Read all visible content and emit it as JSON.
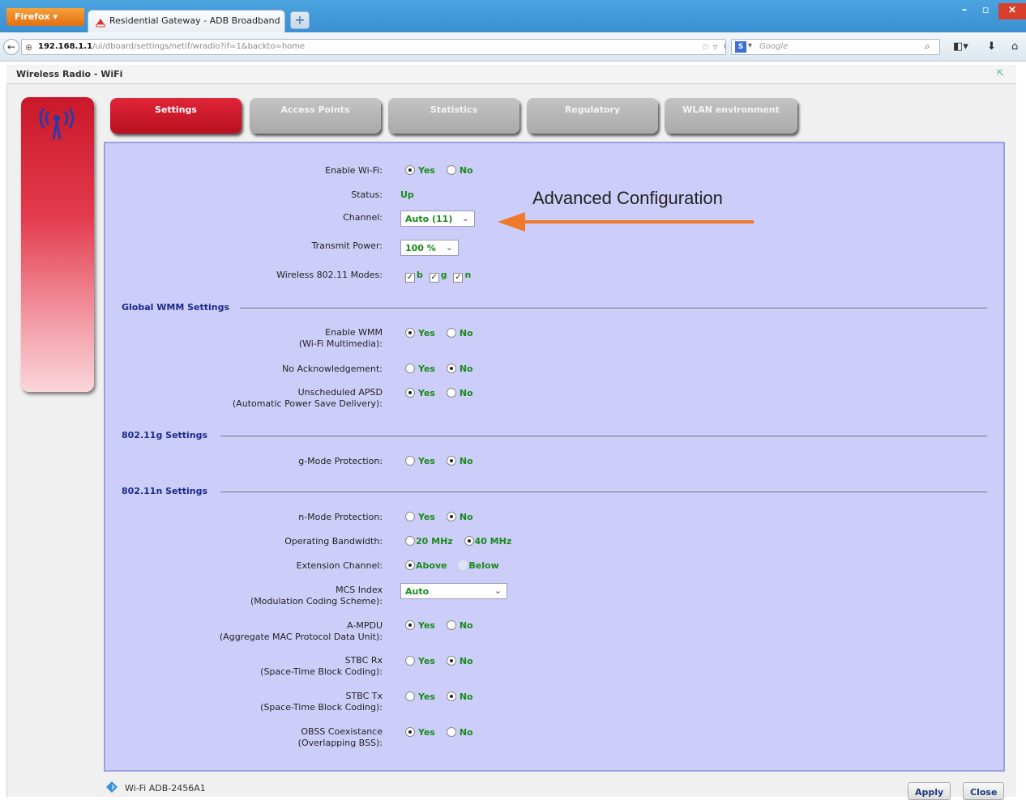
{
  "browser": {
    "menu_button": "Firefox",
    "tab_title": "Residential Gateway - ADB Broadband",
    "new_tab": "+",
    "url_host": "192.168.1.1",
    "url_path": "/ui/dboard/settings/netif/wradio?if=1&backto=home",
    "search_engine": "Google",
    "search_engine_icon": "S",
    "window_minimize": "–",
    "window_maximize": "▫",
    "window_close": "×"
  },
  "page": {
    "title": "Wireless Radio - WiFi"
  },
  "tabs": [
    {
      "label": "Settings",
      "active": true
    },
    {
      "label": "Access Points",
      "active": false
    },
    {
      "label": "Statistics",
      "active": false
    },
    {
      "label": "Regulatory",
      "active": false
    },
    {
      "label": "WLAN environment",
      "active": false
    }
  ],
  "settings": {
    "enable_wifi": {
      "label": "Enable Wi-Fi:",
      "yes": "Yes",
      "no": "No",
      "selected": "yes"
    },
    "status": {
      "label": "Status:",
      "value": "Up"
    },
    "channel": {
      "label": "Channel:",
      "value": "Auto (11)"
    },
    "transmit_power": {
      "label": "Transmit Power:",
      "value": "100 %"
    },
    "modes": {
      "label": "Wireless 802.11 Modes:",
      "b": "b",
      "g": "g",
      "n": "n"
    }
  },
  "wmm": {
    "section": "Global WMM Settings",
    "enable_wmm": {
      "label1": "Enable WMM",
      "label2": "(Wi-Fi Multimedia):",
      "yes": "Yes",
      "no": "No",
      "selected": "yes"
    },
    "no_ack": {
      "label": "No Acknowledgement:",
      "yes": "Yes",
      "no": "No",
      "selected": "no"
    },
    "apsd": {
      "label1": "Unscheduled APSD",
      "label2": "(Automatic Power Save Delivery):",
      "yes": "Yes",
      "no": "No",
      "selected": "yes"
    }
  },
  "g_settings": {
    "section": "802.11g Settings",
    "g_protection": {
      "label": "g-Mode Protection:",
      "yes": "Yes",
      "no": "No",
      "selected": "no"
    }
  },
  "n_settings": {
    "section": "802.11n Settings",
    "n_protection": {
      "label": "n-Mode Protection:",
      "yes": "Yes",
      "no": "No",
      "selected": "no"
    },
    "bandwidth": {
      "label": "Operating Bandwidth:",
      "opt1": "20 MHz",
      "opt2": "40 MHz",
      "selected": "40 MHz"
    },
    "extension": {
      "label": "Extension Channel:",
      "opt1": "Above",
      "opt2": "Below",
      "selected": "Above"
    },
    "mcs": {
      "label1": "MCS Index",
      "label2": "(Modulation Coding Scheme):",
      "value": "Auto"
    },
    "ampdu": {
      "label1": "A-MPDU",
      "label2": "(Aggregate MAC Protocol Data Unit):",
      "yes": "Yes",
      "no": "No",
      "selected": "yes"
    },
    "stbc_rx": {
      "label1": "STBC Rx",
      "label2": "(Space-Time Block Coding):",
      "yes": "Yes",
      "no": "No",
      "selected": "no"
    },
    "stbc_tx": {
      "label1": "STBC Tx",
      "label2": "(Space-Time Block Coding):",
      "yes": "Yes",
      "no": "No",
      "selected": "no"
    },
    "obss": {
      "label1": "OBSS Coexistance",
      "label2": "(Overlapping BSS):",
      "yes": "Yes",
      "no": "No",
      "selected": "yes"
    }
  },
  "annotation": {
    "text": "Advanced Configuration",
    "color": "#f07a2c"
  },
  "footer": {
    "network": "Wi-Fi ADB-2456A1",
    "apply": "Apply",
    "close": "Close"
  },
  "colors": {
    "accent_red": "#c9182a",
    "panel_bg": "#cdcdf9",
    "value_green": "#1a8a1a",
    "section_blue": "#1a2b8a"
  }
}
